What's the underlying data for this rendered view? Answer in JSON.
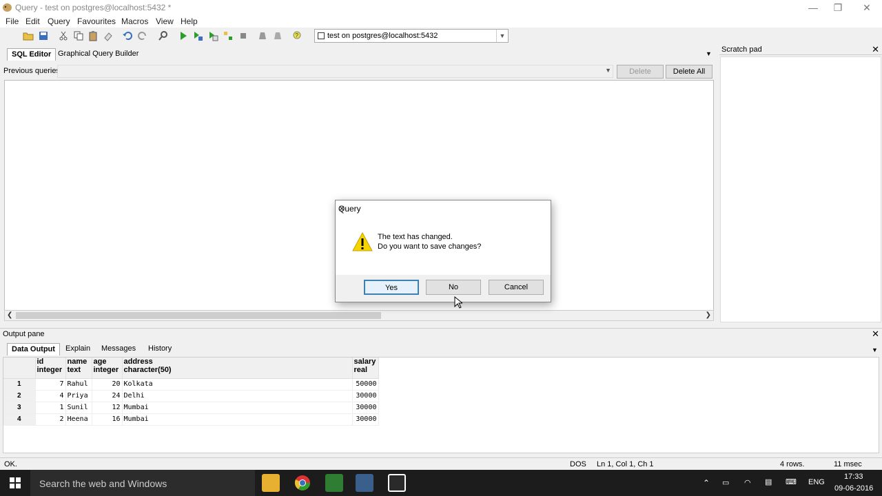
{
  "window": {
    "title": "Query - test on postgres@localhost:5432 *"
  },
  "menu": [
    "File",
    "Edit",
    "Query",
    "Favourites",
    "Macros",
    "View",
    "Help"
  ],
  "connection": {
    "selected": "test on postgres@localhost:5432"
  },
  "editor": {
    "tabs": [
      "SQL Editor",
      "Graphical Query Builder"
    ],
    "previous_queries_label": "Previous queries",
    "delete_label": "Delete",
    "delete_all_label": "Delete All"
  },
  "scratch": {
    "title": "Scratch pad"
  },
  "output": {
    "title": "Output pane",
    "tabs": [
      "Data Output",
      "Explain",
      "Messages",
      "History"
    ],
    "columns": [
      {
        "name": "id",
        "type": "integer"
      },
      {
        "name": "name",
        "type": "text"
      },
      {
        "name": "age",
        "type": "integer"
      },
      {
        "name": "address",
        "type": "character(50)"
      },
      {
        "name": "salary",
        "type": "real"
      }
    ],
    "rows": [
      {
        "n": "1",
        "id": "7",
        "name": "Rahul",
        "age": "20",
        "address": "Kolkata",
        "salary": "50000"
      },
      {
        "n": "2",
        "id": "4",
        "name": "Priya",
        "age": "24",
        "address": "Delhi",
        "salary": "30000"
      },
      {
        "n": "3",
        "id": "1",
        "name": "Sunil",
        "age": "12",
        "address": "Mumbai",
        "salary": "30000"
      },
      {
        "n": "4",
        "id": "2",
        "name": "Heena",
        "age": "16",
        "address": "Mumbai",
        "salary": "30000"
      }
    ]
  },
  "status": {
    "message": "OK.",
    "encoding": "DOS",
    "position": "Ln 1, Col 1, Ch 1",
    "rows": "4 rows.",
    "time": "11 msec"
  },
  "dialog": {
    "title": "Query",
    "line1": "The text has changed.",
    "line2": "Do you want to save changes?",
    "yes": "Yes",
    "no": "No",
    "cancel": "Cancel"
  },
  "taskbar": {
    "search_placeholder": "Search the web and Windows",
    "lang": "ENG",
    "time": "17:33",
    "date": "09-06-2016"
  }
}
